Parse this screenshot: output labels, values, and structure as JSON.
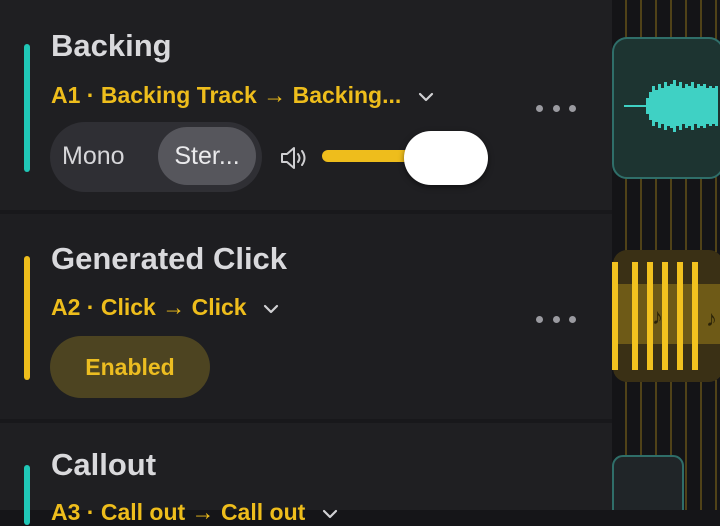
{
  "colors": {
    "accent_teal": "#20c7b7",
    "accent_yellow": "#eebd1c",
    "text_primary": "#d9d9dc",
    "panel_bg": "#1e1e21"
  },
  "tracks": [
    {
      "name": "Backing",
      "route": "A1 · Backing Track → Backing...",
      "channel_mode": {
        "options": [
          "Mono",
          "Ster..."
        ],
        "selected": "Ster..."
      },
      "volume_icon": "speaker-icon",
      "volume_level": 1.0
    },
    {
      "name": "Generated Click",
      "route": "A2 · Click → Click",
      "status_button": "Enabled"
    },
    {
      "name": "Callout",
      "route": "A3 · Call out → Call out"
    }
  ],
  "clips": {
    "click_label": "♪"
  }
}
